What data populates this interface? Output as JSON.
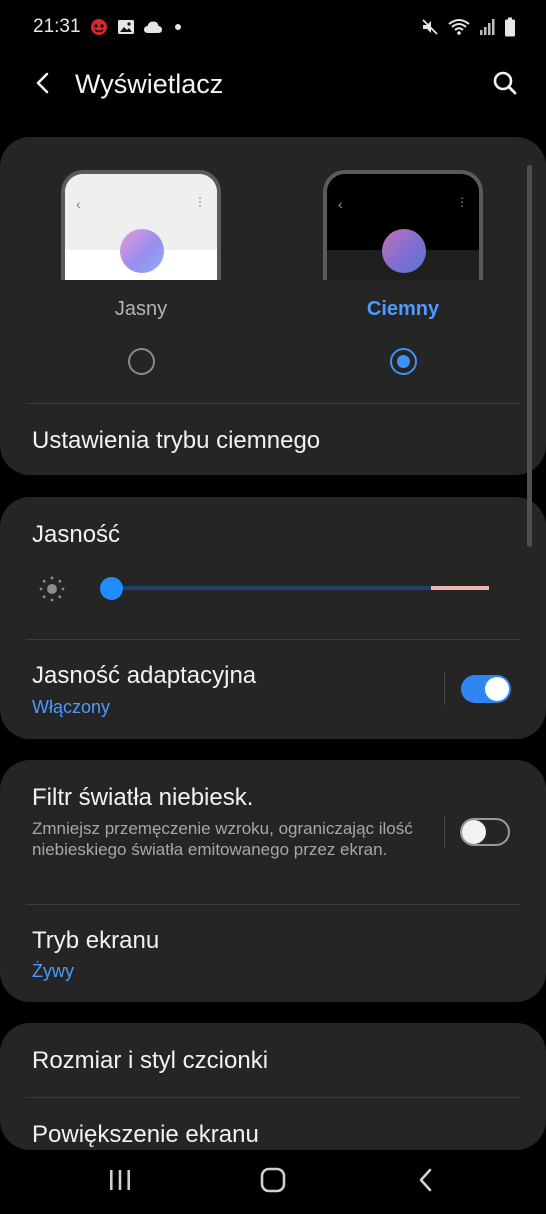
{
  "status_bar": {
    "time": "21:31",
    "left_icons": [
      "app-notification-icon",
      "gallery-icon",
      "cloud-icon",
      "dot-icon"
    ],
    "right_icons": [
      "mute-icon",
      "wifi-icon",
      "signal-icon",
      "battery-icon"
    ]
  },
  "header": {
    "title": "Wyświetlacz",
    "back_icon": "back-arrow-icon",
    "search_icon": "search-icon"
  },
  "theme": {
    "light_label": "Jasny",
    "dark_label": "Ciemny",
    "selected": "dark",
    "dark_mode_settings": "Ustawienia trybu ciemnego"
  },
  "brightness": {
    "title": "Jasność",
    "level_fraction": 0.0,
    "adaptive_title": "Jasność adaptacyjna",
    "adaptive_status": "Włączony",
    "adaptive_on": true
  },
  "blue_filter": {
    "title": "Filtr światła niebiesk.",
    "description": "Zmniejsz przemęczenie wzroku, ograniczając ilość niebieskiego światła emitowanego przez ekran.",
    "enabled": false
  },
  "screen_mode": {
    "title": "Tryb ekranu",
    "value": "Żywy"
  },
  "font": {
    "title": "Rozmiar i styl czcionki"
  },
  "zoom": {
    "title": "Powiększenie ekranu"
  },
  "colors": {
    "accent": "#4d9bff",
    "card_bg": "#252525",
    "background": "#000000"
  },
  "navbar": {
    "icons": [
      "recents-icon",
      "home-icon",
      "back-icon"
    ]
  }
}
